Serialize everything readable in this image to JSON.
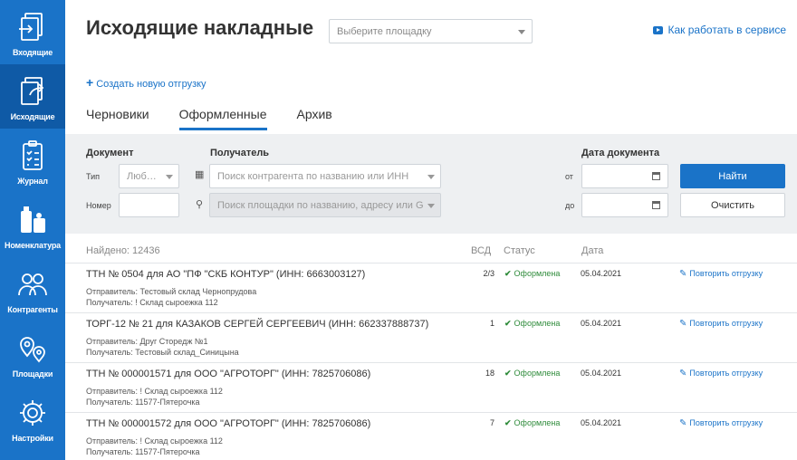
{
  "sidebar": {
    "items": [
      {
        "label": "Входящие",
        "icon": "incoming-icon"
      },
      {
        "label": "Исходящие",
        "icon": "outgoing-icon",
        "active": true
      },
      {
        "label": "Журнал",
        "icon": "journal-icon"
      },
      {
        "label": "Номенклатура",
        "icon": "nomenclature-icon"
      },
      {
        "label": "Контрагенты",
        "icon": "contractors-icon"
      },
      {
        "label": "Площадки",
        "icon": "locations-icon"
      },
      {
        "label": "Настройки",
        "icon": "gear-icon"
      }
    ]
  },
  "header": {
    "title": "Исходящие накладные",
    "site_select_placeholder": "Выберите площадку",
    "help_link": "Как работать в сервисе"
  },
  "create_link": "Создать новую отгрузку",
  "tabs": [
    {
      "label": "Черновики",
      "active": false
    },
    {
      "label": "Оформленные",
      "active": true
    },
    {
      "label": "Архив",
      "active": false
    }
  ],
  "filters": {
    "document_label": "Документ",
    "type_label": "Тип",
    "type_value": "Люб…",
    "number_label": "Номер",
    "recipient_label": "Получатель",
    "recipient_placeholder": "Поиск контрагента по названию или ИНН",
    "site_placeholder": "Поиск площадки по названию, адресу или G",
    "date_label": "Дата документа",
    "from_label": "от",
    "to_label": "до",
    "find_button": "Найти",
    "clear_button": "Очистить"
  },
  "results": {
    "found": "Найдено: 12436",
    "col_vsd": "ВСД",
    "col_status": "Статус",
    "col_date": "Дата",
    "rows": [
      {
        "title": "ТТН № 0504 для АО \"ПФ \"СКБ КОНТУР\" (ИНН: 6663003127)",
        "sender": "Отправитель: Тестовый склад Чернопрудова",
        "recipient": "Получатель: ! Склад сыроежка 112",
        "vsd": "2/3",
        "status": "Оформлена",
        "date": "05.04.2021",
        "action": "Повторить отгрузку"
      },
      {
        "title": "ТОРГ-12 № 21 для КАЗАКОВ СЕРГЕЙ СЕРГЕЕВИЧ (ИНН: 662337888737)",
        "sender": "Отправитель: Друг Сторедж №1",
        "recipient": "Получатель: Тестовый склад_Синицына",
        "vsd": "1",
        "status": "Оформлена",
        "date": "05.04.2021",
        "action": "Повторить отгрузку"
      },
      {
        "title": "ТТН № 000001571 для ООО \"АГРОТОРГ\" (ИНН: 7825706086)",
        "sender": "Отправитель: ! Склад сыроежка 112",
        "recipient": "Получатель: 11577-Пятерочка",
        "vsd": "18",
        "status": "Оформлена",
        "date": "05.04.2021",
        "action": "Повторить отгрузку"
      },
      {
        "title": "ТТН № 000001572 для ООО \"АГРОТОРГ\" (ИНН: 7825706086)",
        "sender": "Отправитель: ! Склад сыроежка 112",
        "recipient": "Получатель: 11577-Пятерочка",
        "vsd": "7",
        "status": "Оформлена",
        "date": "05.04.2021",
        "action": "Повторить отгрузку"
      }
    ]
  },
  "colors": {
    "sidebar": "#1a73c8",
    "sidebar_active": "#0f5aa6",
    "accent": "#1a73c8",
    "status_ok": "#2e8b3a"
  }
}
